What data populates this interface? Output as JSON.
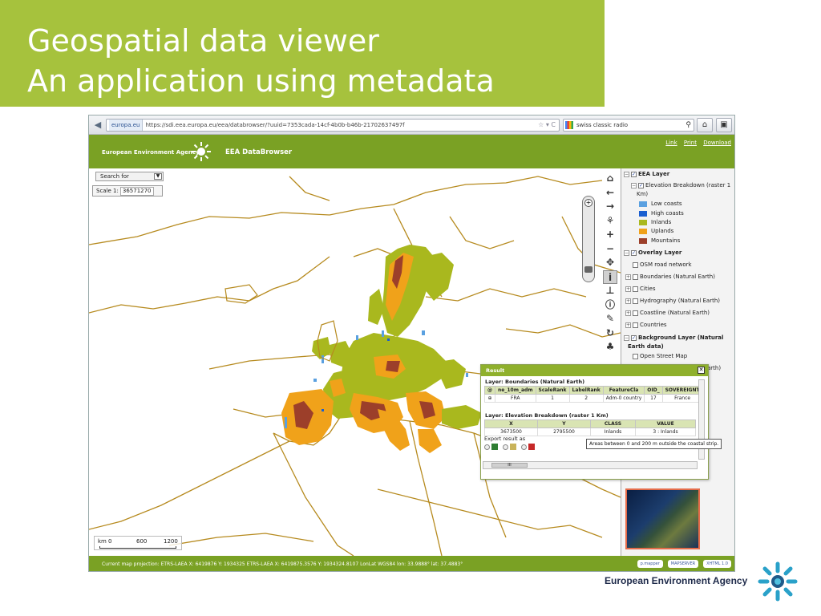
{
  "slide": {
    "title_line1": "Geospatial data viewer",
    "title_line2": "An application using metadata",
    "accent_color": "#a6c23d",
    "footer_org": "European Environment Agency"
  },
  "browser": {
    "site_badge": "europa.eu",
    "url": "https://sdi.eea.europa.eu/eea/databrowser/?uuid=7353cada-14cf-4b0b-b46b-21702637497f",
    "search_query": "swiss classic radio"
  },
  "app": {
    "agency_label": "European Environment Agency",
    "app_name": "EEA DataBrowser",
    "header_color": "#7aa124",
    "links": [
      "Link",
      "Print",
      "Download"
    ]
  },
  "map": {
    "search_for": "Search for",
    "scale_label": "Scale 1:",
    "scale_value": "36571270",
    "scalebar": {
      "unit": "km",
      "ticks": [
        "0",
        "600",
        "1200"
      ]
    },
    "status": "Current map projection: ETRS-LAEA X: 6419876 Y: 1934325    ETRS-LAEA X: 6419875.3576 Y: 1934324.8107    LonLat WGS84 lon: 33.9888° lat: 37.4883°",
    "status_logos": [
      "p.mapper",
      "MAPSERVER",
      "XHTML 1.0"
    ]
  },
  "legend": {
    "eea_layer": "EEA Layer",
    "elevation": "Elevation Breakdown (raster 1",
    "elevation_cont": "Km)",
    "classes": [
      {
        "label": "Low coasts",
        "color": "#5aa0e0"
      },
      {
        "label": "High coasts",
        "color": "#1a5fd0"
      },
      {
        "label": "Inlands",
        "color": "#a9b81e"
      },
      {
        "label": "Uplands",
        "color": "#f0a21a"
      },
      {
        "label": "Mountains",
        "color": "#9c3f2a"
      }
    ],
    "overlay_layer": "Overlay Layer",
    "overlay_items": [
      "OSM road network",
      "Boundaries (Natural Earth)",
      "Cities",
      "Hydrography (Natural Earth)",
      "Coastline (Natural Earth)",
      "Countries"
    ],
    "background_layer": "Background Layer (Natural",
    "background_cont": "Earth data)",
    "background_items": [
      "Open Street Map"
    ],
    "partial_text": "arth)"
  },
  "result": {
    "title": "Result",
    "layer1_title": "Layer: Boundaries (Natural Earth)",
    "layer1_headers": [
      "@",
      "ne_10m_adm",
      "ScaleRank",
      "LabelRank",
      "FeatureCla",
      "OID_",
      "SOVEREIGNT"
    ],
    "layer1_row": [
      "",
      "FRA",
      "1",
      "2",
      "Adm-0 country",
      "17",
      "France"
    ],
    "layer2_title": "Layer: Elevation Breakdown (raster 1 Km)",
    "layer2_headers": [
      "X",
      "Y",
      "CLASS",
      "VALUE"
    ],
    "layer2_row": [
      "3673500",
      "2795500",
      "Inlands",
      "3 : Inlands"
    ],
    "export_label": "Export result as",
    "hscroll_label": "III"
  },
  "tooltip": "Areas between 0 and 200 m outside the coastal strip."
}
